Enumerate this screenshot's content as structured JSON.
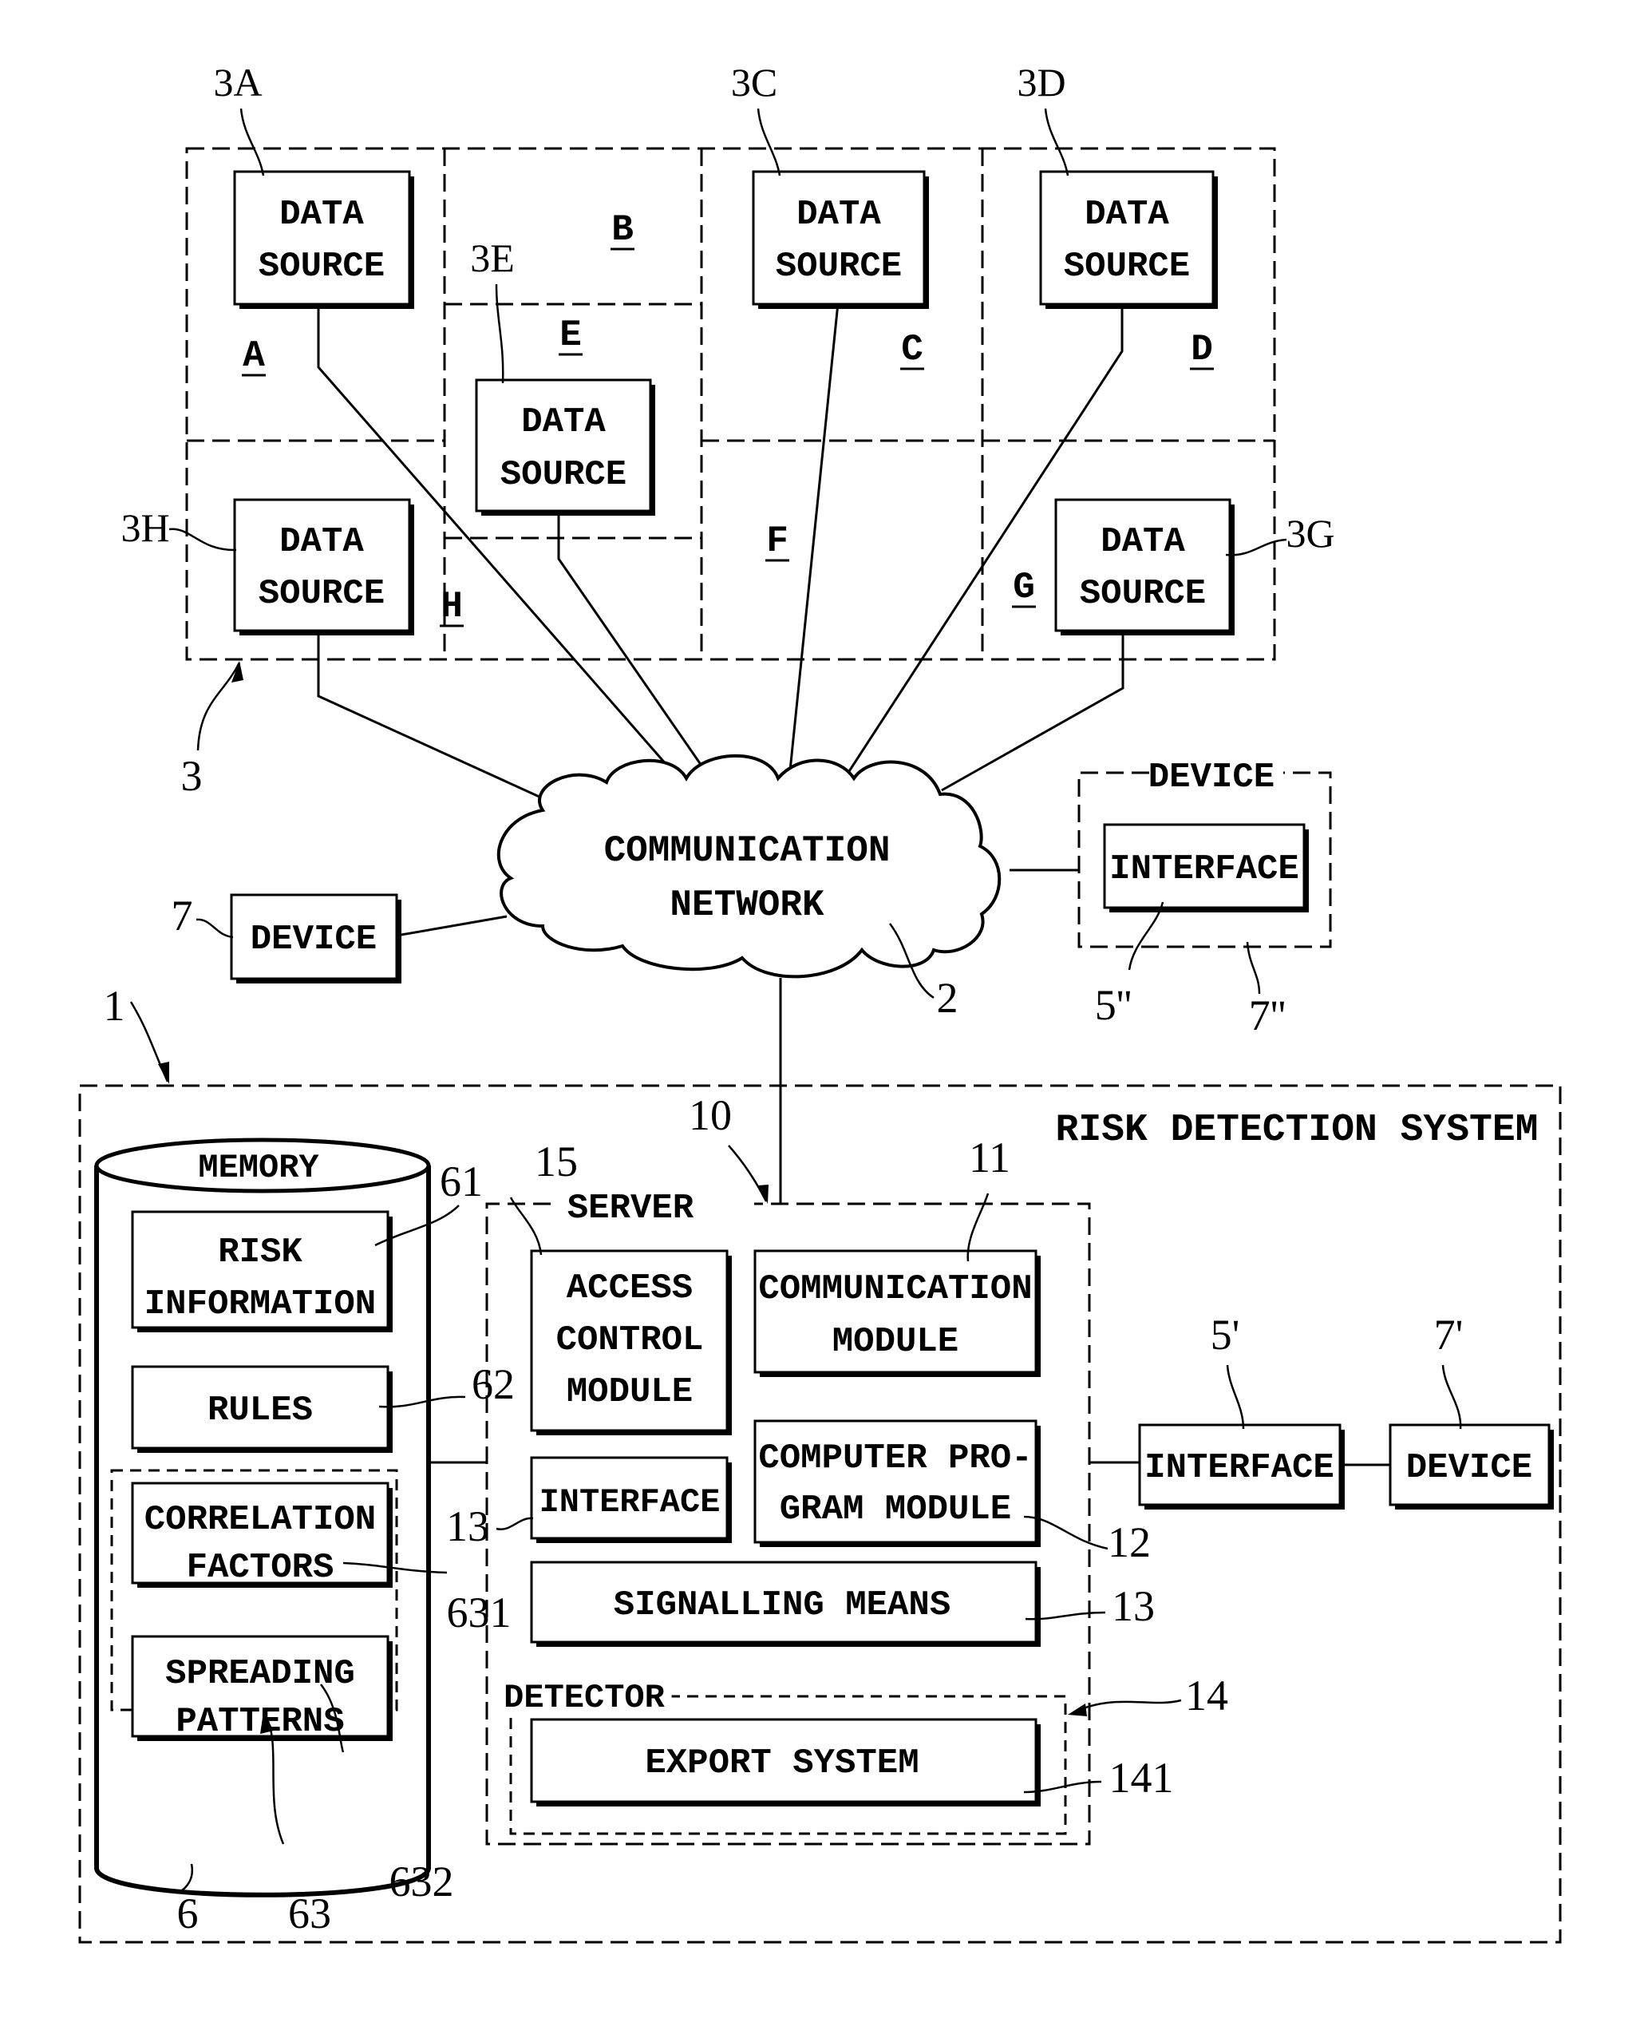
{
  "diagram": {
    "title": "RISK DETECTION SYSTEM",
    "region_group": {
      "ref": "3",
      "areas": [
        {
          "id": "A",
          "label": "A"
        },
        {
          "id": "B",
          "label": "B"
        },
        {
          "id": "C",
          "label": "C"
        },
        {
          "id": "D",
          "label": "D"
        },
        {
          "id": "E",
          "label": "E"
        },
        {
          "id": "F",
          "label": "F"
        },
        {
          "id": "G",
          "label": "G"
        },
        {
          "id": "H",
          "label": "H"
        }
      ],
      "data_sources": [
        {
          "ref": "3A",
          "line1": "DATA",
          "line2": "SOURCE",
          "area": "A"
        },
        {
          "ref": "3C",
          "line1": "DATA",
          "line2": "SOURCE",
          "area": "C"
        },
        {
          "ref": "3D",
          "line1": "DATA",
          "line2": "SOURCE",
          "area": "D"
        },
        {
          "ref": "3E",
          "line1": "DATA",
          "line2": "SOURCE",
          "area": "E"
        },
        {
          "ref": "3H",
          "line1": "DATA",
          "line2": "SOURCE",
          "area": "H"
        },
        {
          "ref": "3G",
          "line1": "DATA",
          "line2": "SOURCE",
          "area": "G"
        }
      ]
    },
    "network": {
      "ref": "2",
      "line1": "COMMUNICATION",
      "line2": "NETWORK"
    },
    "device_7": {
      "ref": "7",
      "label": "DEVICE"
    },
    "device_7pp": {
      "ref": "7''",
      "label": "DEVICE",
      "interface_label": "INTERFACE",
      "interface_ref": "5''"
    },
    "system": {
      "ref": "1",
      "title": "RISK DETECTION SYSTEM",
      "memory": {
        "ref": "6",
        "label": "MEMORY",
        "items": [
          {
            "ref": "61",
            "line1": "RISK",
            "line2": "INFORMATION"
          },
          {
            "ref": "62",
            "line1": "RULES",
            "line2": ""
          }
        ],
        "group": {
          "ref": "63",
          "items": [
            {
              "ref": "631",
              "line1": "CORRELATION",
              "line2": "FACTORS"
            },
            {
              "ref": "632",
              "line1": "SPREADING",
              "line2": "PATTERNS"
            }
          ]
        }
      },
      "server": {
        "ref": "10",
        "label": "SERVER",
        "access_control": {
          "ref": "15",
          "line1": "ACCESS",
          "line2": "CONTROL",
          "line3": "MODULE"
        },
        "communication_module": {
          "ref": "11",
          "line1": "COMMUNICATION",
          "line2": "MODULE"
        },
        "interface": {
          "ref": "13",
          "label": "INTERFACE"
        },
        "computer_program_module": {
          "ref": "12",
          "line1": "COMPUTER PRO-",
          "line2": "GRAM MODULE"
        },
        "signalling_means": {
          "ref": "13",
          "label": "SIGNALLING MEANS"
        },
        "detector": {
          "ref": "14",
          "label": "DETECTOR",
          "export_system": {
            "ref": "141",
            "label": "EXPORT SYSTEM"
          }
        }
      },
      "interface_5p": {
        "ref": "5'",
        "label": "INTERFACE"
      },
      "device_7p": {
        "ref": "7'",
        "label": "DEVICE"
      }
    }
  }
}
